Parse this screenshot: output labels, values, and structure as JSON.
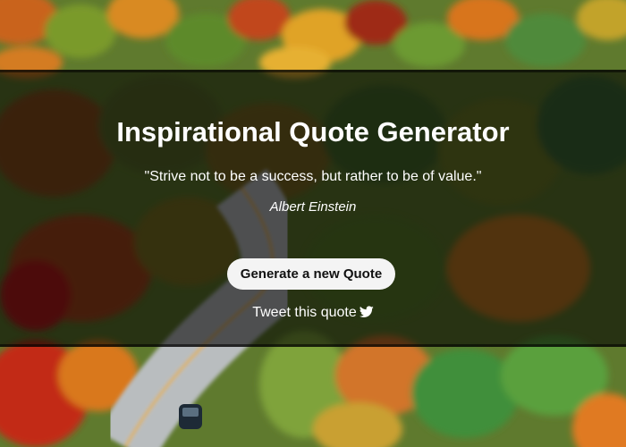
{
  "app": {
    "title": "Inspirational Quote Generator"
  },
  "quote": {
    "text": "\"Strive not to be a success, but rather to be of value.\"",
    "author": "Albert Einstein"
  },
  "actions": {
    "generate_label": "Generate a new Quote",
    "tweet_label": "Tweet this quote",
    "tweet_icon": "twitter-bird-icon"
  },
  "colors": {
    "band": "#000000",
    "text": "#ffffff",
    "button_bg": "#f4f4f4",
    "button_text": "#111111"
  }
}
